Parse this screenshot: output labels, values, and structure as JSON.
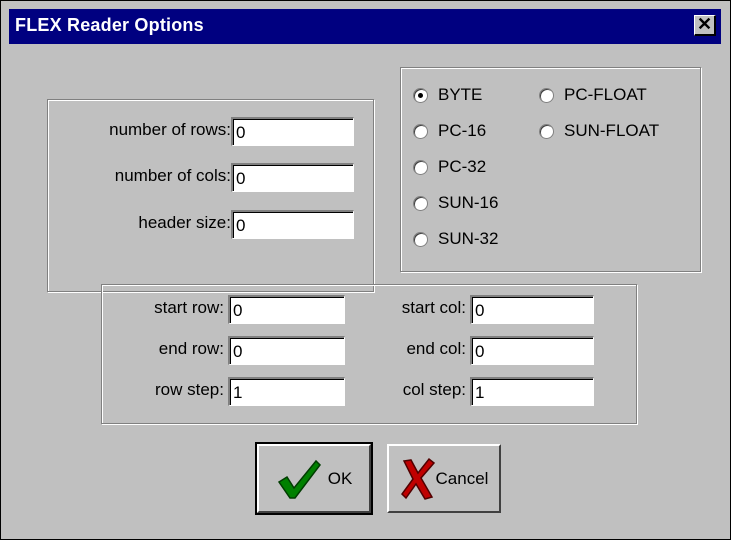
{
  "window": {
    "title": "FLEX Reader Options",
    "close_glyph": "✕"
  },
  "dimensions": {
    "rows": {
      "label": "number of rows:",
      "value": "0"
    },
    "cols": {
      "label": "number of cols:",
      "value": "0"
    },
    "header": {
      "label": "header size:",
      "value": "0"
    }
  },
  "data_type": {
    "selected": "BYTE",
    "options": [
      "BYTE",
      "PC-16",
      "PC-32",
      "SUN-16",
      "SUN-32",
      "PC-FLOAT",
      "SUN-FLOAT"
    ]
  },
  "subset": {
    "start_row": {
      "label": "start row:",
      "value": "0"
    },
    "end_row": {
      "label": "end row:",
      "value": "0"
    },
    "row_step": {
      "label": "row step:",
      "value": "1"
    },
    "start_col": {
      "label": "start col:",
      "value": "0"
    },
    "end_col": {
      "label": "end col:",
      "value": "0"
    },
    "col_step": {
      "label": "col step:",
      "value": "1"
    }
  },
  "buttons": {
    "ok": {
      "label": "OK",
      "icon": "checkmark-icon",
      "icon_color": "#008000"
    },
    "cancel": {
      "label": "Cancel",
      "icon": "x-mark-icon",
      "icon_color": "#c00000"
    }
  }
}
